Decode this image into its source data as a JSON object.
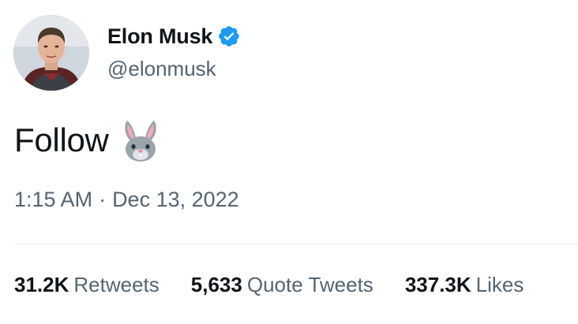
{
  "author": {
    "display_name": "Elon Musk",
    "handle": "@elonmusk",
    "verified": true,
    "verified_color": "#1d9bf0",
    "avatar_icon": "profile-photo"
  },
  "tweet": {
    "text": "Follow",
    "emoji_icon": "rabbit-face-emoji",
    "time": "1:15 AM",
    "separator": "·",
    "date": "Dec 13, 2022"
  },
  "stats": [
    {
      "count": "31.2K",
      "label": "Retweets"
    },
    {
      "count": "5,633",
      "label": "Quote Tweets"
    },
    {
      "count": "337.3K",
      "label": "Likes"
    }
  ]
}
